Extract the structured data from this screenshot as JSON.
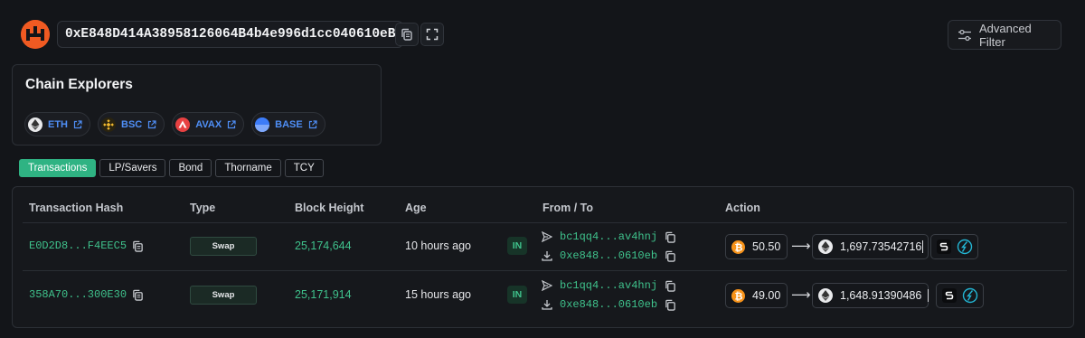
{
  "header": {
    "address": "0xE848D414A38958126064B4b4e996d1cc040610eB",
    "advanced_filter_label": "Advanced Filter"
  },
  "explorers": {
    "title": "Chain Explorers",
    "chains": [
      {
        "label": "ETH",
        "color": "#627eea"
      },
      {
        "label": "BSC",
        "color": "#f3ba2f"
      },
      {
        "label": "AVAX",
        "color": "#e84142"
      },
      {
        "label": "BASE",
        "color": "#0052ff"
      }
    ]
  },
  "tabs": [
    "Transactions",
    "LP/Savers",
    "Bond",
    "Thorname",
    "TCY"
  ],
  "active_tab": "Transactions",
  "table": {
    "columns": [
      "Transaction Hash",
      "Type",
      "Block Height",
      "Age",
      "From / To",
      "Action"
    ],
    "rows": [
      {
        "hash": "E0D2D8...F4EEC5",
        "type": "Swap",
        "block": "25,174,644",
        "age": "10 hours ago",
        "direction": "IN",
        "from": "bc1qq4...av4hnj",
        "to": "0xe848...0610eb",
        "in_amount": "50.50",
        "in_asset": "BTC",
        "out_amount": "1,697.73542716",
        "out_asset": "ETH"
      },
      {
        "hash": "358A70...300E30",
        "type": "Swap",
        "block": "25,171,914",
        "age": "15 hours ago",
        "direction": "IN",
        "from": "bc1qq4...av4hnj",
        "to": "0xe848...0610eb",
        "in_amount": "49.00",
        "in_asset": "BTC",
        "out_amount": "1,648.91390486",
        "out_asset": "ETH"
      }
    ]
  },
  "colors": {
    "accent_green": "#3fc28c",
    "btc_orange": "#f7931a",
    "link_blue": "#4f8ff7",
    "logo_orange": "#f05a22"
  }
}
